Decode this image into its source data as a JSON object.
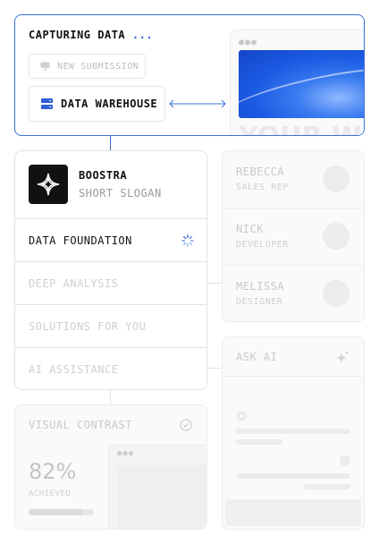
{
  "capture": {
    "title": "CAPTURING DATA",
    "title_ellipsis": "...",
    "new_submission": "NEW SUBMISSION",
    "data_warehouse": "DATA WAREHOUSE",
    "preview_headline": "YOUR W"
  },
  "brand": {
    "name": "BOOSTRA",
    "slogan": "SHORT SLOGAN"
  },
  "menu": {
    "items": [
      {
        "label": "DATA FOUNDATION",
        "active": true
      },
      {
        "label": "DEEP ANALYSIS",
        "active": false
      },
      {
        "label": "SOLUTIONS FOR YOU",
        "active": false
      },
      {
        "label": "AI ASSISTANCE",
        "active": false
      }
    ]
  },
  "team": {
    "members": [
      {
        "name": "REBECCA",
        "role": "SALES REP"
      },
      {
        "name": "NICK",
        "role": "DEVELOPER"
      },
      {
        "name": "MELISSA",
        "role": "DESIGNER"
      }
    ]
  },
  "ask_ai": {
    "title": "ASK AI"
  },
  "visual_contrast": {
    "title": "VISUAL CONTRAST",
    "percent": "82%",
    "percent_value": 0.82,
    "label": "ACHIEVED"
  },
  "colors": {
    "accent": "#2d5fd6",
    "border_active": "#3b6fd8",
    "connector": "#3b6fd8",
    "muted_connector": "#e3e3e3"
  },
  "icons": {
    "submission": "monitor-icon",
    "warehouse": "database-icon",
    "arrows": "bidirectional-arrow-icon",
    "logo": "sparkle-star-logo",
    "loading": "spinner-icon",
    "ai": "sparkles-icon",
    "check": "check-circle-icon"
  }
}
